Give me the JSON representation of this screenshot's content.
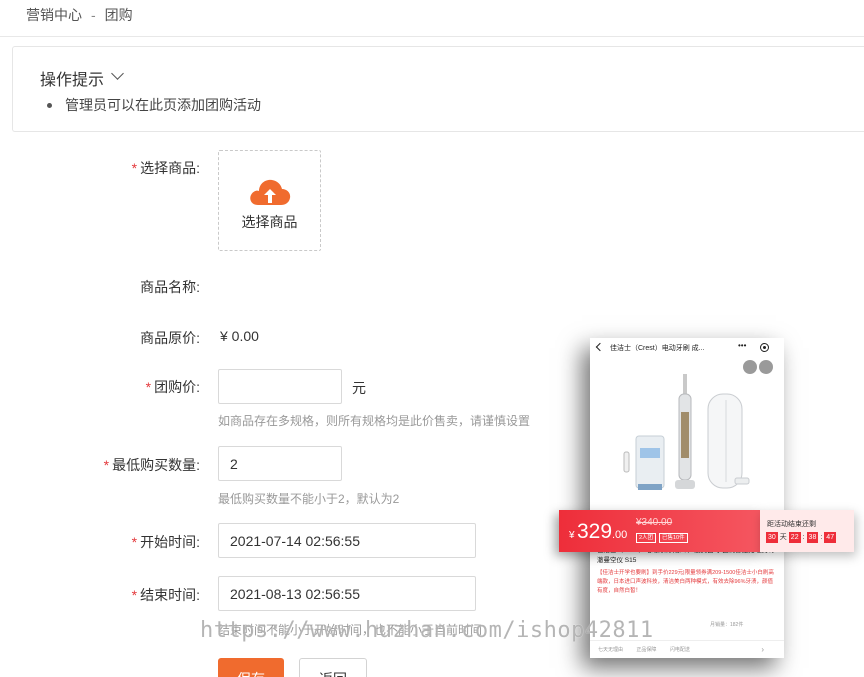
{
  "breadcrumb": {
    "parent": "营销中心",
    "separator": "-",
    "current": "团购"
  },
  "tips": {
    "title": "操作提示",
    "items": [
      "管理员可以在此页添加团购活动"
    ]
  },
  "form": {
    "product": {
      "label": "选择商品:",
      "upload_text": "选择商品"
    },
    "name": {
      "label": "商品名称:",
      "value": ""
    },
    "original_price": {
      "label": "商品原价:",
      "value": "¥ 0.00"
    },
    "group_price": {
      "label": "团购价:",
      "value": "",
      "unit": "元",
      "hint": "如商品存在多规格，则所有规格均是此价售卖，请谨慎设置"
    },
    "min_qty": {
      "label": "最低购买数量:",
      "value": "2",
      "hint": "最低购买数量不能小于2，默认为2"
    },
    "start_time": {
      "label": "开始时间:",
      "value": "2021-07-14 02:56:55"
    },
    "end_time": {
      "label": "结束时间:",
      "value": "2021-08-13 02:56:55",
      "hint": "结束时间不能小于开始时间，也不能小于当前时间"
    },
    "save_label": "保存",
    "back_label": "返回"
  },
  "watermark": "https://www.huzhan.com/ishop42811",
  "preview": {
    "title": "佳洁士（Crest）电动牙刷 成...",
    "more": "•••",
    "price_yen": "¥",
    "price_int": "329",
    "price_dec": ".00",
    "old_price": "¥340.00",
    "tag_group": "2人团",
    "tag_sold": "已售10件",
    "countdown_label": "距活动结束还剩",
    "countdown": {
      "days": "30",
      "day_unit": "天",
      "hours": "22",
      "minutes": "38",
      "seconds": "47"
    },
    "product_name": "佳洁士（Crest）电动牙刷 成人 声波美白 小白刷智能充电式 净澈曼空仪 S15",
    "product_desc": "【佳洁士开学也要刷】到手价229元|限量领券满209-1500佳洁士小白刷高端款，日本进口声波科技，清洁美白两种模式，有效去除96%牙渍，颜值有度，自然白皙！",
    "sales": "月销量：182件",
    "services": [
      "七天无理由",
      "正品保障",
      "闪电配送"
    ]
  },
  "colors": {
    "accent": "#f06b2e",
    "required": "#e4393c",
    "promo_red": "#ee2e3a"
  }
}
